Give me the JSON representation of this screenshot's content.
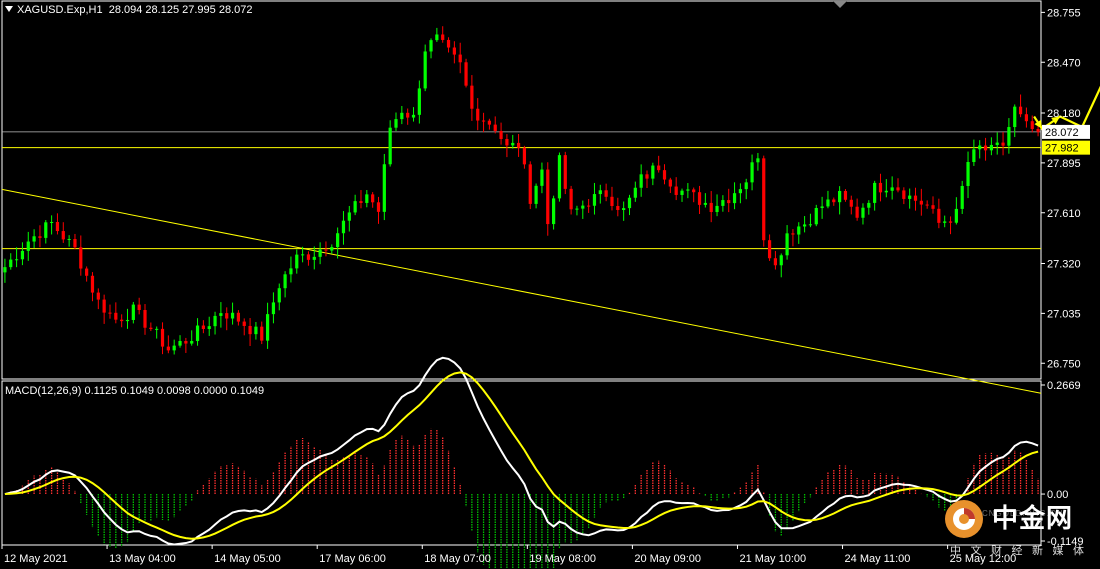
{
  "header": {
    "symbol": "XAGUSD.Exp,H1",
    "ohlc": "28.094 28.125 27.995 28.072"
  },
  "macd_header": "MACD(12,26,9) 0.1125 0.1049 0.0098 0.0000 0.1049",
  "watermark": {
    "brand": "中金网",
    "url": "CNGOLD.ORG.CN",
    "tagline": "中 文 财 经 新 媒 体"
  },
  "colors": {
    "background": "#000000",
    "bull_candle": "#00ff00",
    "bear_candle": "#ff0000",
    "level_line": "#ffff00",
    "current_price_line": "#c0c0c0",
    "macd_line": "#ffffff",
    "signal_line": "#ffff00",
    "hist_up": "#ff3030",
    "hist_down": "#00c000"
  },
  "chart_data": [
    {
      "type": "candlestick",
      "title": "XAGUSD.Exp,H1",
      "x_tick_labels": [
        "12 May 2021",
        "13 May 04:00",
        "14 May 05:00",
        "17 May 06:00",
        "18 May 07:00",
        "19 May 08:00",
        "20 May 09:00",
        "21 May 10:00",
        "24 May 11:00",
        "25 May 12:00"
      ],
      "y_tick_labels": [
        "28.755",
        "28.470",
        "28.180",
        "27.895",
        "27.610",
        "27.320",
        "27.035",
        "26.750"
      ],
      "ylim": [
        26.66,
        28.82
      ],
      "current_price": "28.072",
      "horizontal_levels": [
        "27.982",
        27.405
      ],
      "trendline": {
        "from": [
          "12 May 2021",
          27.74
        ],
        "to": [
          "25 May 12:00",
          26.68
        ]
      },
      "close_path": [
        [
          0,
          27.3
        ],
        [
          4,
          27.45
        ],
        [
          8,
          27.55
        ],
        [
          12,
          27.4
        ],
        [
          16,
          27.1
        ],
        [
          19,
          27.0
        ],
        [
          22,
          27.05
        ],
        [
          25,
          26.95
        ],
        [
          28,
          26.83
        ],
        [
          31,
          26.88
        ],
        [
          34,
          26.95
        ],
        [
          37,
          27.05
        ],
        [
          40,
          27.0
        ],
        [
          44,
          26.9
        ],
        [
          47,
          27.2
        ],
        [
          50,
          27.35
        ],
        [
          53,
          27.38
        ],
        [
          56,
          27.45
        ],
        [
          59,
          27.6
        ],
        [
          62,
          27.72
        ],
        [
          64,
          27.62
        ],
        [
          66,
          28.1
        ],
        [
          68,
          28.2
        ],
        [
          70,
          28.15
        ],
        [
          72,
          28.55
        ],
        [
          74,
          28.6
        ],
        [
          76,
          28.52
        ],
        [
          78,
          28.45
        ],
        [
          80,
          28.2
        ],
        [
          82,
          28.15
        ],
        [
          84,
          28.1
        ],
        [
          86,
          27.98
        ],
        [
          88,
          28.0
        ],
        [
          90,
          27.7
        ],
        [
          92,
          27.85
        ],
        [
          93,
          27.55
        ],
        [
          95,
          27.9
        ],
        [
          97,
          27.6
        ],
        [
          100,
          27.68
        ],
        [
          103,
          27.72
        ],
        [
          106,
          27.62
        ],
        [
          109,
          27.8
        ],
        [
          112,
          27.88
        ],
        [
          115,
          27.75
        ],
        [
          118,
          27.7
        ],
        [
          121,
          27.65
        ],
        [
          124,
          27.7
        ],
        [
          127,
          27.8
        ],
        [
          129,
          27.95
        ],
        [
          130,
          27.48
        ],
        [
          132,
          27.3
        ],
        [
          134,
          27.5
        ],
        [
          137,
          27.55
        ],
        [
          140,
          27.65
        ],
        [
          143,
          27.7
        ],
        [
          146,
          27.6
        ],
        [
          149,
          27.75
        ],
        [
          152,
          27.78
        ],
        [
          155,
          27.7
        ],
        [
          158,
          27.65
        ],
        [
          160,
          27.55
        ],
        [
          163,
          27.6
        ],
        [
          165,
          27.9
        ],
        [
          167,
          27.98
        ],
        [
          169,
          27.96
        ],
        [
          171,
          28.0
        ],
        [
          173,
          28.2
        ],
        [
          175,
          28.1
        ],
        [
          177,
          28.07
        ]
      ],
      "projection_arrows": "yellow zig-zag arrows pointing up"
    },
    {
      "type": "macd",
      "title": "MACD(12,26,9)",
      "params": [
        12,
        26,
        9
      ],
      "values": {
        "main": 0.1125,
        "signal": 0.1049,
        "histogram": 0.0098
      },
      "y_tick_labels": [
        "0.2669",
        "0.00",
        "-0.1149"
      ],
      "ylim": [
        -0.1149,
        0.2669
      ]
    }
  ]
}
